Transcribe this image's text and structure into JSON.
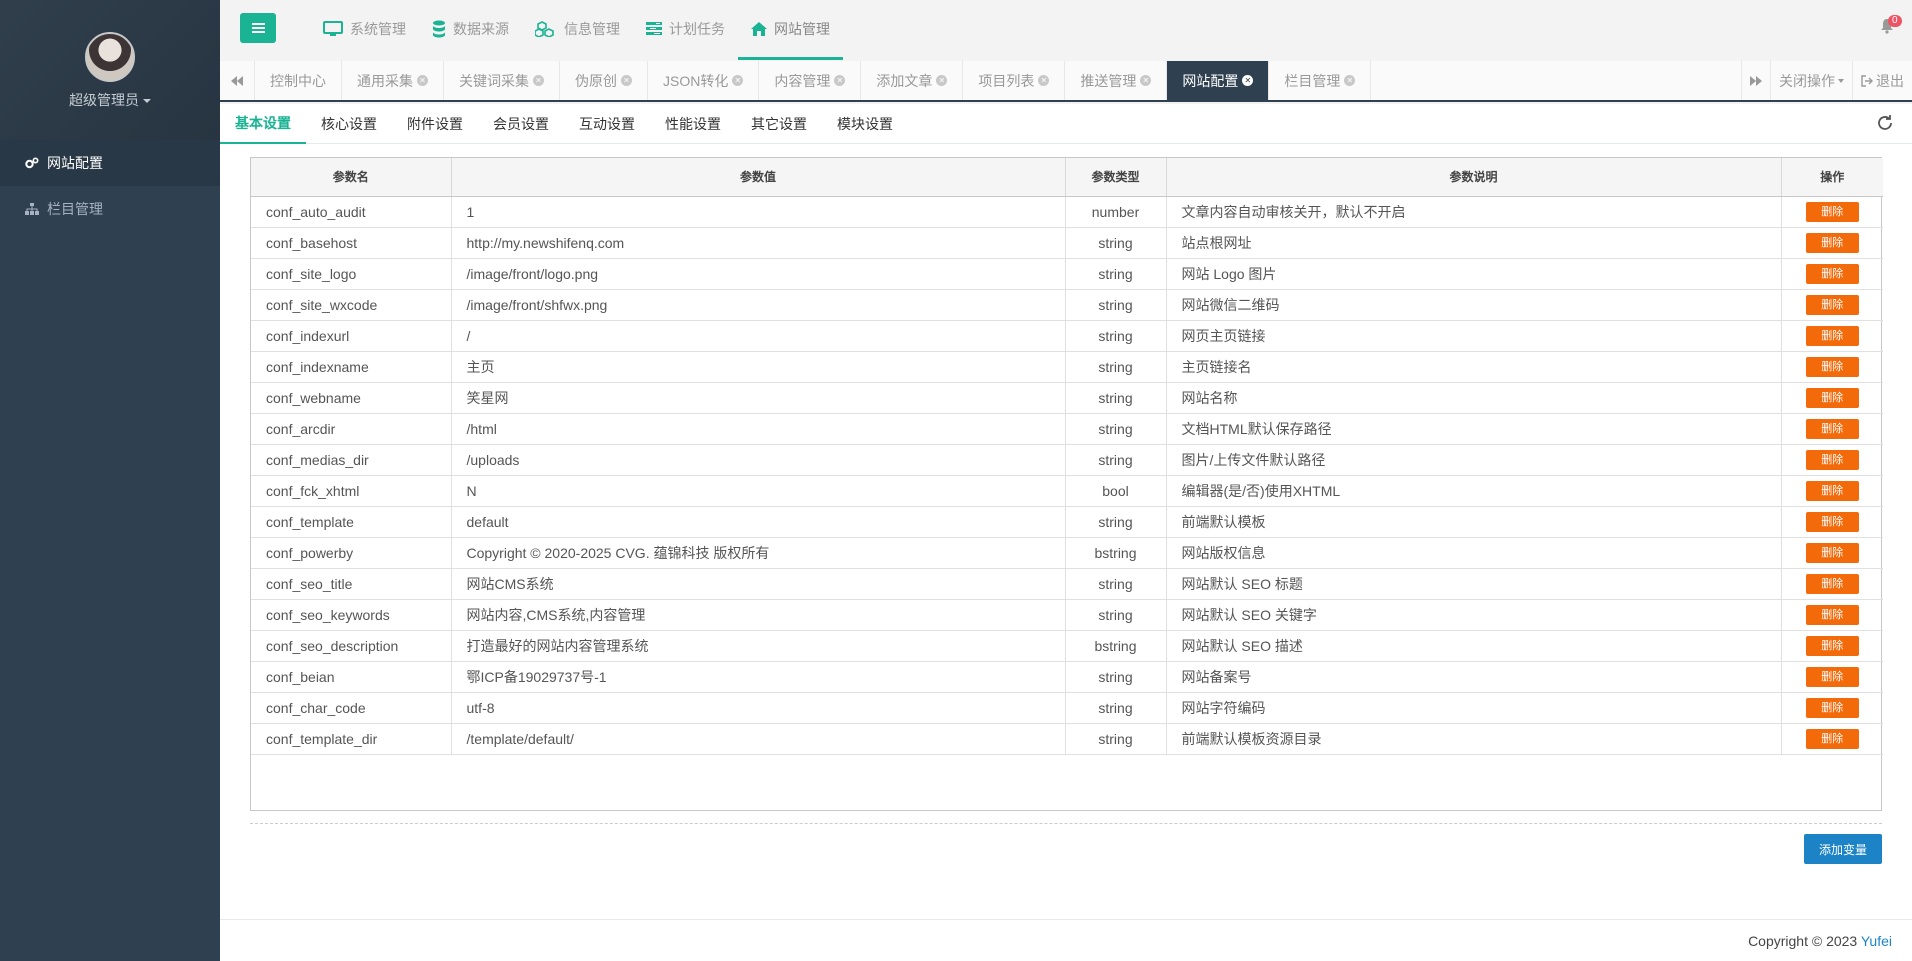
{
  "sidebar": {
    "user_name": "超级管理员",
    "items": [
      {
        "label": "网站配置",
        "icon": "gears-icon"
      },
      {
        "label": "栏目管理",
        "icon": "sitemap-icon"
      }
    ]
  },
  "topnav": {
    "items": [
      {
        "label": "系统管理",
        "icon": "monitor-icon"
      },
      {
        "label": "数据来源",
        "icon": "database-icon"
      },
      {
        "label": "信息管理",
        "icon": "cubes-icon"
      },
      {
        "label": "计划任务",
        "icon": "tasks-icon"
      },
      {
        "label": "网站管理",
        "icon": "home-icon"
      }
    ],
    "notification_count": "0"
  },
  "tabs": {
    "items": [
      "控制中心",
      "通用采集",
      "关键词采集",
      "伪原创",
      "JSON转化",
      "内容管理",
      "添加文章",
      "项目列表",
      "推送管理",
      "网站配置",
      "栏目管理"
    ],
    "close_ops": "关闭操作",
    "logout": "退出"
  },
  "subtabs": [
    "基本设置",
    "核心设置",
    "附件设置",
    "会员设置",
    "互动设置",
    "性能设置",
    "其它设置",
    "模块设置"
  ],
  "table": {
    "headers": [
      "参数名",
      "参数值",
      "参数类型",
      "参数说明",
      "操作"
    ],
    "delete_label": "删除",
    "rows": [
      [
        "conf_auto_audit",
        "1",
        "number",
        "文章内容自动审核关开，默认不开启"
      ],
      [
        "conf_basehost",
        "http://my.newshifenq.com",
        "string",
        "站点根网址"
      ],
      [
        "conf_site_logo",
        "/image/front/logo.png",
        "string",
        "网站 Logo 图片"
      ],
      [
        "conf_site_wxcode",
        "/image/front/shfwx.png",
        "string",
        "网站微信二维码"
      ],
      [
        "conf_indexurl",
        "/",
        "string",
        "网页主页链接"
      ],
      [
        "conf_indexname",
        "主页",
        "string",
        "主页链接名"
      ],
      [
        "conf_webname",
        "笑星网",
        "string",
        "网站名称"
      ],
      [
        "conf_arcdir",
        "/html",
        "string",
        "文档HTML默认保存路径"
      ],
      [
        "conf_medias_dir",
        "/uploads",
        "string",
        "图片/上传文件默认路径"
      ],
      [
        "conf_fck_xhtml",
        "N",
        "bool",
        "编辑器(是/否)使用XHTML"
      ],
      [
        "conf_template",
        "default",
        "string",
        "前端默认模板"
      ],
      [
        "conf_powerby",
        "Copyright © 2020-2025 CVG. 蕴锦科技 版权所有",
        "bstring",
        "网站版权信息"
      ],
      [
        "conf_seo_title",
        "网站CMS系统",
        "string",
        "网站默认 SEO 标题"
      ],
      [
        "conf_seo_keywords",
        "网站内容,CMS系统,内容管理",
        "string",
        "网站默认 SEO 关键字"
      ],
      [
        "conf_seo_description",
        "打造最好的网站内容管理系统",
        "bstring",
        "网站默认 SEO 描述"
      ],
      [
        "conf_beian",
        "鄂ICP备19029737号-1",
        "string",
        "网站备案号"
      ],
      [
        "conf_char_code",
        "utf-8",
        "string",
        "网站字符编码"
      ],
      [
        "conf_template_dir",
        "/template/default/",
        "string",
        "前端默认模板资源目录"
      ]
    ]
  },
  "add_button": "添加变量",
  "footer": {
    "text": "Copyright © 2023",
    "link": "Yufei"
  }
}
